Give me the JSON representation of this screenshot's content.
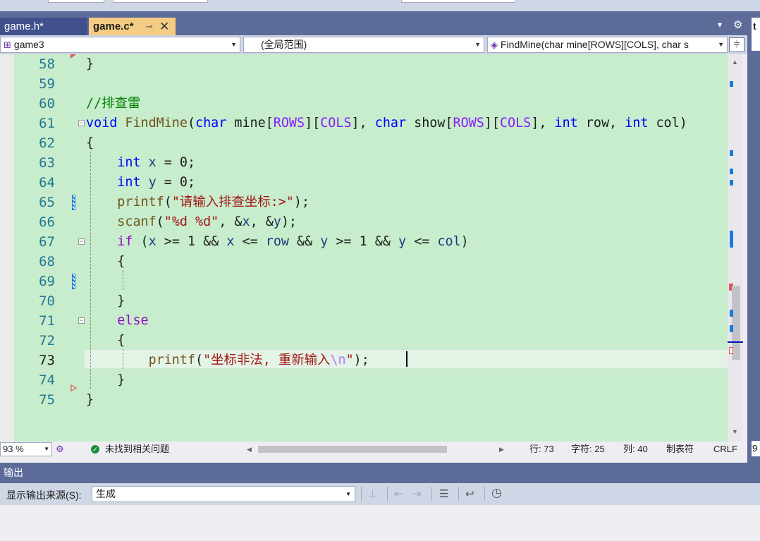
{
  "tabs": [
    {
      "label": "game.h*",
      "active": false
    },
    {
      "label": "game.c*",
      "active": true
    }
  ],
  "tab_icons": {
    "pin": "⊸",
    "close": "✕",
    "dropdown": "▾",
    "gear": "⚙"
  },
  "right_tab_fragment": "t",
  "right_bottom_fragment": "9",
  "nav": {
    "project": "game3",
    "scope": "(全局范围)",
    "member": "FindMine(char mine[ROWS][COLS], char s"
  },
  "code_lines": [
    {
      "num": "58"
    },
    {
      "num": "59"
    },
    {
      "num": "60"
    },
    {
      "num": "61"
    },
    {
      "num": "62"
    },
    {
      "num": "63"
    },
    {
      "num": "64"
    },
    {
      "num": "65"
    },
    {
      "num": "66"
    },
    {
      "num": "67"
    },
    {
      "num": "68"
    },
    {
      "num": "69"
    },
    {
      "num": "70"
    },
    {
      "num": "71"
    },
    {
      "num": "72"
    },
    {
      "num": "73"
    },
    {
      "num": "74"
    },
    {
      "num": "75"
    }
  ],
  "code": {
    "l58": "}",
    "l60": "//排查雷",
    "l61_void": "void",
    "l61_fn": "FindMine",
    "l61_p1": "(",
    "l61_char1": "char",
    "l61_mine": "mine",
    "l61_b1": "[",
    "l61_rows1": "ROWS",
    "l61_b2": "][",
    "l61_cols1": "COLS",
    "l61_b3": "],",
    "l61_char2": "char",
    "l61_show": "show",
    "l61_b4": "[",
    "l61_rows2": "ROWS",
    "l61_b5": "][",
    "l61_cols2": "COLS",
    "l61_b6": "],",
    "l61_int1": "int",
    "l61_row": "row",
    "l61_comma": ",",
    "l61_int2": "int",
    "l61_col": "col",
    "l61_p2": ")",
    "l62": "{",
    "l63_int": "int",
    "l63_x": "x",
    "l63_rest": "= 0;",
    "l64_int": "int",
    "l64_y": "y",
    "l64_rest": "= 0;",
    "l65_fn": "printf",
    "l65_p1": "(",
    "l65_str": "\"请输入排查坐标:>\"",
    "l65_p2": ");",
    "l66_fn": "scanf",
    "l66_p1": "(",
    "l66_str": "\"%d %d\"",
    "l66_a": ", &",
    "l66_x": "x",
    "l66_b": ", &",
    "l66_y": "y",
    "l66_p2": ");",
    "l67_if": "if",
    "l67_a": "(",
    "l67_x1": "x",
    "l67_b": ">= 1 &&",
    "l67_x2": "x",
    "l67_c": "<=",
    "l67_row": "row",
    "l67_d": "&&",
    "l67_y1": "y",
    "l67_e": ">= 1 &&",
    "l67_y2": "y",
    "l67_f": "<=",
    "l67_col": "col",
    "l67_g": ")",
    "l68": "{",
    "l70": "}",
    "l71": "else",
    "l72": "{",
    "l73_fn": "printf",
    "l73_p1": "(",
    "l73_str1": "\"坐标非法, 重新输入",
    "l73_esc": "\\n",
    "l73_str2": "\"",
    "l73_p2": ");",
    "l74": "}",
    "l75": "}"
  },
  "status": {
    "zoom": "93 %",
    "issues": "未找到相关问题",
    "line": "行: 73",
    "char": "字符: 25",
    "col": "列: 40",
    "indent": "制表符",
    "eol": "CRLF"
  },
  "output": {
    "title": "输出",
    "source_label": "显示输出来源(S):",
    "source_value": "生成"
  },
  "colors": {
    "editor_bg": "#c7edcc",
    "tab_active": "#f5cc84",
    "chrome": "#5d6b99",
    "keyword": "#0000ff",
    "string": "#a31515",
    "comment": "#008000"
  }
}
